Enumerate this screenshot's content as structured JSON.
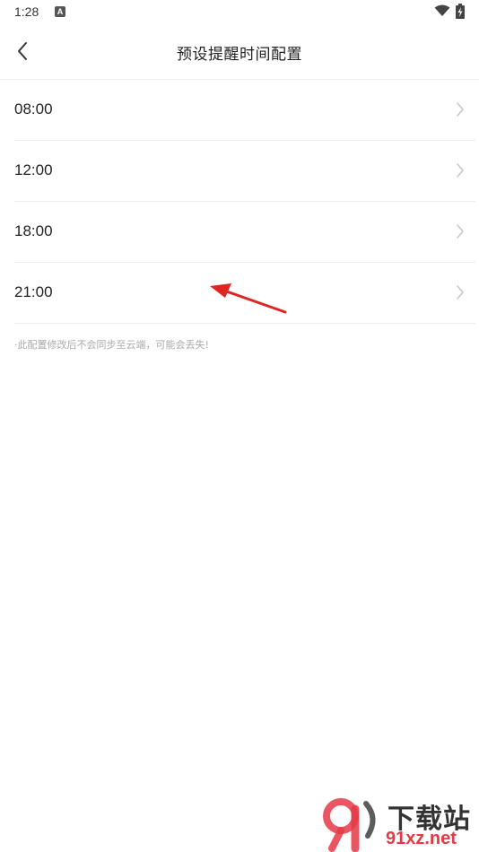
{
  "status_bar": {
    "time": "1:28",
    "notification_icon": "a-badge-icon",
    "wifi_icon": "wifi-icon",
    "battery_icon": "battery-charging-icon"
  },
  "header": {
    "title": "预设提醒时间配置",
    "back_icon": "chevron-left-icon"
  },
  "times": [
    {
      "label": "08:00"
    },
    {
      "label": "12:00"
    },
    {
      "label": "18:00"
    },
    {
      "label": "21:00"
    }
  ],
  "notice": "·此配置修改后不会同步至云端，可能会丢失!",
  "watermark": {
    "title": "下载站",
    "url": "91xz.net"
  },
  "colors": {
    "arrow": "#e02424",
    "divider": "#eeeeee",
    "notice_text": "#aaaaaa",
    "watermark_red": "#e63946"
  }
}
